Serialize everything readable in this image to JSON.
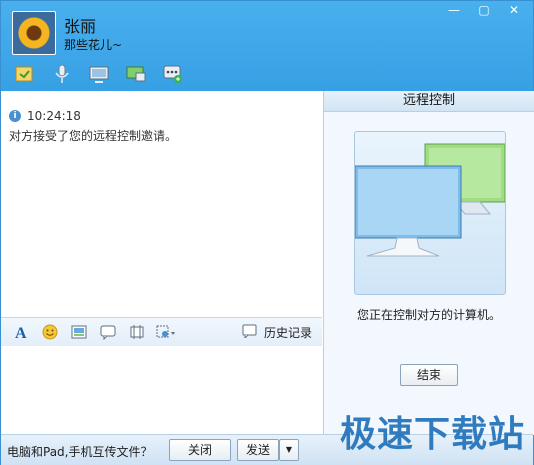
{
  "contact": {
    "name": "张丽",
    "signature": "那些花儿~"
  },
  "window_controls": {
    "minimize": "—",
    "maximize": "▢",
    "close": "✕"
  },
  "toolbar_icons": [
    "file-transfer-icon",
    "voice-icon",
    "video-icon",
    "remote-desktop-icon",
    "more-apps-icon"
  ],
  "chat": {
    "message_time": "10:24:18",
    "message_text": "对方接受了您的远程控制邀请。"
  },
  "format_bar": {
    "history_label": "历史记录"
  },
  "remote_panel": {
    "title": "远程控制",
    "status_text": "您正在控制对方的计算机。",
    "end_button": "结束"
  },
  "bottom_bar": {
    "transfer_prompt": "电脑和Pad,手机互传文件？",
    "close_button": "关闭",
    "send_button": "发送",
    "send_arrow": "▼"
  },
  "watermark": "极速下载站"
}
